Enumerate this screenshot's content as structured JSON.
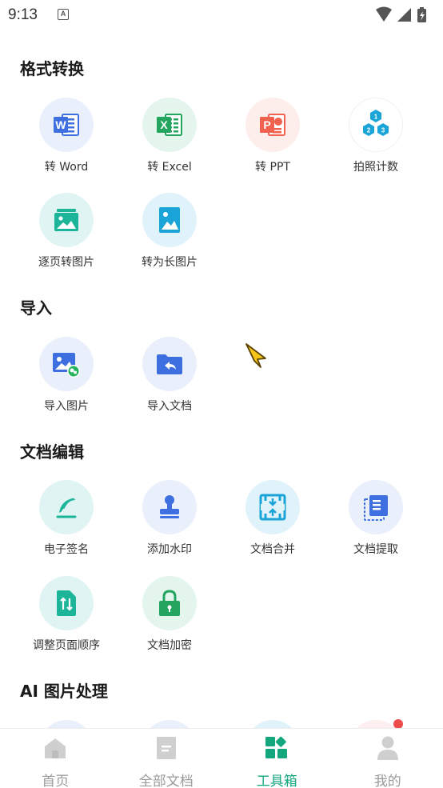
{
  "status_bar": {
    "time": "9:13",
    "notif_icon": "A"
  },
  "sections": {
    "convert": {
      "title": "格式转换"
    },
    "import": {
      "title": "导入"
    },
    "edit": {
      "title": "文档编辑"
    },
    "ai": {
      "title": "AI 图片处理"
    }
  },
  "tools": {
    "to_word": "转 Word",
    "to_excel": "转 Excel",
    "to_ppt": "转 PPT",
    "photo_count": "拍照计数",
    "page_to_image": "逐页转图片",
    "to_long_image": "转为长图片",
    "import_image": "导入图片",
    "import_doc": "导入文档",
    "e_signature": "电子签名",
    "watermark": "添加水印",
    "merge_doc": "文档合并",
    "extract_doc": "文档提取",
    "reorder_pages": "调整页面顺序",
    "encrypt_doc": "文档加密"
  },
  "tabbar": {
    "home": "首页",
    "all_docs": "全部文档",
    "toolbox": "工具箱",
    "mine": "我的"
  },
  "colors": {
    "accent": "#13a77e",
    "word": "#3d6fe0",
    "excel": "#23a55f",
    "ppt": "#f0624f",
    "count": "#1aa4d8",
    "badge": "#ee4b4b"
  }
}
